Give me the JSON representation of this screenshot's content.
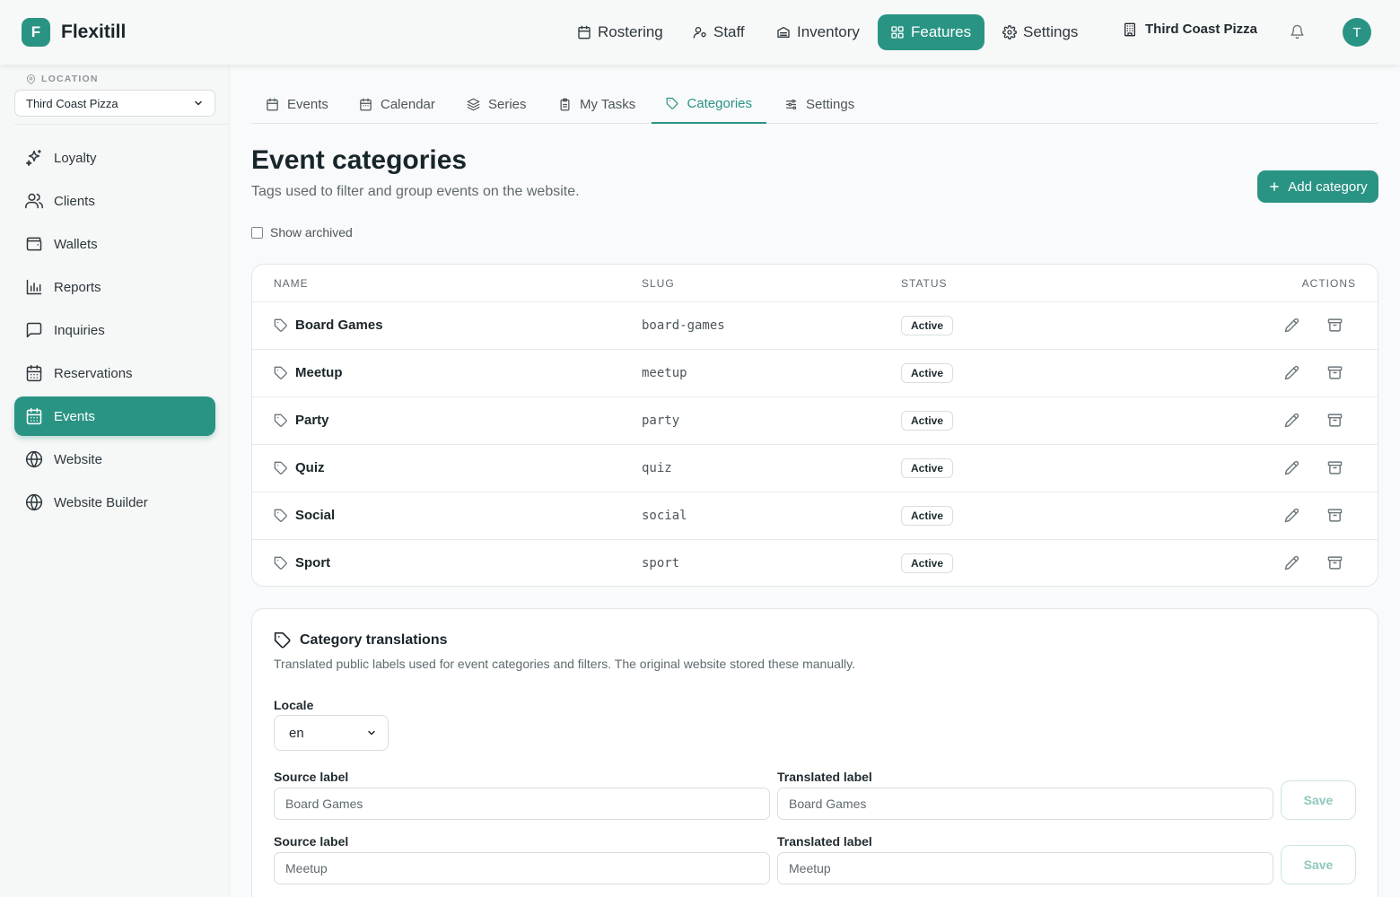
{
  "app": {
    "logo_letter": "F",
    "name": "Flexitill",
    "user_initial": "T",
    "location_button": "Third Coast Pizza"
  },
  "topnav": [
    {
      "label": "Rostering",
      "icon": "calendar-icon"
    },
    {
      "label": "Staff",
      "icon": "staff-icon"
    },
    {
      "label": "Inventory",
      "icon": "inventory-icon"
    },
    {
      "label": "Features",
      "icon": "grid-icon",
      "active": true
    },
    {
      "label": "Settings",
      "icon": "gear-icon"
    }
  ],
  "sidebar": {
    "location_label": "LOCATION",
    "location_value": "Third Coast Pizza",
    "items": [
      {
        "label": "Loyalty",
        "icon": "sparkles-icon"
      },
      {
        "label": "Clients",
        "icon": "users-icon"
      },
      {
        "label": "Wallets",
        "icon": "wallet-icon"
      },
      {
        "label": "Reports",
        "icon": "bar-chart-icon"
      },
      {
        "label": "Inquiries",
        "icon": "message-icon"
      },
      {
        "label": "Reservations",
        "icon": "calendar-icon"
      },
      {
        "label": "Events",
        "icon": "calendar-icon",
        "active": true
      },
      {
        "label": "Website",
        "icon": "globe-icon"
      },
      {
        "label": "Website Builder",
        "icon": "globe-icon"
      }
    ]
  },
  "tabs": [
    {
      "label": "Events",
      "icon": "calendar-icon"
    },
    {
      "label": "Calendar",
      "icon": "calendar-icon"
    },
    {
      "label": "Series",
      "icon": "layers-icon"
    },
    {
      "label": "My Tasks",
      "icon": "clipboard-icon"
    },
    {
      "label": "Categories",
      "icon": "tag-icon",
      "active": true
    },
    {
      "label": "Settings",
      "icon": "sliders-icon"
    }
  ],
  "page": {
    "title": "Event categories",
    "subtitle": "Tags used to filter and group events on the website.",
    "add_button": "Add category",
    "show_archived": "Show archived"
  },
  "table": {
    "headers": {
      "name": "NAME",
      "slug": "SLUG",
      "status": "STATUS",
      "actions": "ACTIONS"
    },
    "rows": [
      {
        "name": "Board Games",
        "slug": "board-games",
        "status": "Active"
      },
      {
        "name": "Meetup",
        "slug": "meetup",
        "status": "Active"
      },
      {
        "name": "Party",
        "slug": "party",
        "status": "Active"
      },
      {
        "name": "Quiz",
        "slug": "quiz",
        "status": "Active"
      },
      {
        "name": "Social",
        "slug": "social",
        "status": "Active"
      },
      {
        "name": "Sport",
        "slug": "sport",
        "status": "Active"
      }
    ]
  },
  "translations": {
    "title": "Category translations",
    "subtitle": "Translated public labels used for event categories and filters. The original website stored these manually.",
    "locale_label": "Locale",
    "locale_value": "en",
    "source_label": "Source label",
    "translated_label": "Translated label",
    "save_label": "Save",
    "rows": [
      {
        "source": "Board Games",
        "translated": "Board Games"
      },
      {
        "source": "Meetup",
        "translated": "Meetup"
      }
    ]
  },
  "colors": {
    "accent": "#2a9484",
    "text": "#1f2a30",
    "muted": "#5f6a6f"
  }
}
